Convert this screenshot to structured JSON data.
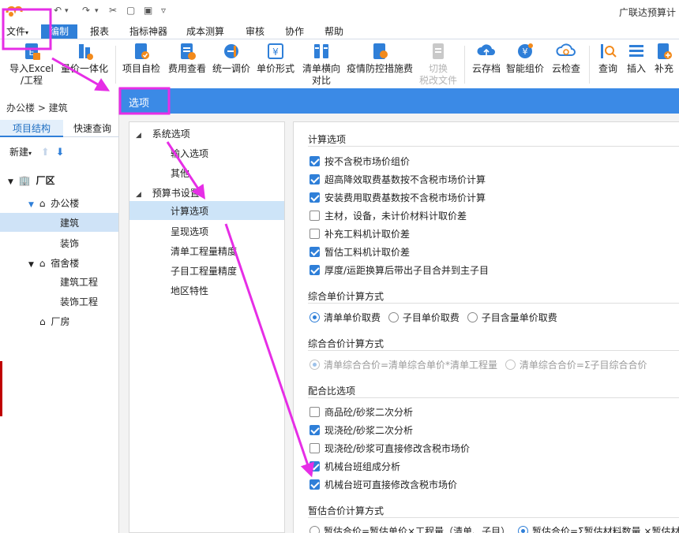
{
  "app": {
    "title": "广联达预算计",
    "quick_access": [
      "↶",
      "▾",
      "↷",
      "▾",
      "✂",
      "▢",
      "▣",
      "▿"
    ]
  },
  "menu": {
    "file": "文件",
    "tabs": [
      "编制",
      "报表",
      "指标神器",
      "成本测算",
      "审核",
      "协作",
      "帮助"
    ],
    "active_tab": "编制"
  },
  "toolbar": {
    "items": [
      {
        "label": "导入Excel",
        "label2": "/工程",
        "icon": "import-excel-icon"
      },
      {
        "label": "量价一体化",
        "label2": "",
        "icon": "quantity-price-icon"
      },
      {
        "label": "项目自检",
        "label2": "",
        "icon": "project-check-icon"
      },
      {
        "label": "费用查看",
        "label2": "",
        "icon": "cost-view-icon"
      },
      {
        "label": "统一调价",
        "label2": "",
        "icon": "price-adjust-icon"
      },
      {
        "label": "单价形式",
        "label2": "",
        "icon": "unit-price-icon"
      },
      {
        "label": "清单横向",
        "label2": "对比",
        "icon": "list-compare-icon"
      },
      {
        "label": "疫情防控措施费",
        "label2": "",
        "icon": "epidemic-fee-icon"
      },
      {
        "label": "切换",
        "label2": "税改文件",
        "icon": "tax-switch-icon"
      },
      {
        "label": "云存档",
        "label2": "",
        "icon": "cloud-archive-icon"
      },
      {
        "label": "智能组价",
        "label2": "",
        "icon": "smart-price-icon"
      },
      {
        "label": "云检查",
        "label2": "",
        "icon": "cloud-check-icon"
      },
      {
        "label": "查询",
        "label2": "",
        "icon": "query-icon"
      },
      {
        "label": "插入",
        "label2": "",
        "icon": "insert-icon"
      },
      {
        "label": "补充",
        "label2": "",
        "icon": "supplement-icon"
      }
    ]
  },
  "sidebar": {
    "breadcrumb": "办公楼 > 建筑",
    "tabs": [
      "项目结构",
      "快速查询"
    ],
    "new_label": "新建",
    "tree": [
      {
        "label": "厂区",
        "level": 0
      },
      {
        "label": "办公楼",
        "level": 1
      },
      {
        "label": "建筑",
        "level": 2
      },
      {
        "label": "装饰",
        "level": 2
      },
      {
        "label": "宿舍楼",
        "level": 1
      },
      {
        "label": "建筑工程",
        "level": 2
      },
      {
        "label": "装饰工程",
        "level": 2
      },
      {
        "label": "厂房",
        "level": 1
      }
    ]
  },
  "dialog": {
    "title": "选项",
    "tree": [
      {
        "label": "系统选项",
        "level": 0
      },
      {
        "label": "输入选项",
        "level": 1
      },
      {
        "label": "其他",
        "level": 1
      },
      {
        "label": "预算书设置",
        "level": 0
      },
      {
        "label": "计算选项",
        "level": 1
      },
      {
        "label": "呈现选项",
        "level": 1
      },
      {
        "label": "清单工程量精度",
        "level": 1
      },
      {
        "label": "子目工程量精度",
        "level": 1
      },
      {
        "label": "地区特性",
        "level": 1
      }
    ],
    "sections": {
      "calc": {
        "title": "计算选项",
        "options": [
          {
            "label": "按不含税市场价组价",
            "checked": true
          },
          {
            "label": "超高降效取费基数按不含税市场价计算",
            "checked": true
          },
          {
            "label": "安装费用取费基数按不含税市场价计算",
            "checked": true
          },
          {
            "label": "主材，设备，未计价材料计取价差",
            "checked": false
          },
          {
            "label": "补充工料机计取价差",
            "checked": false
          },
          {
            "label": "暂估工料机计取价差",
            "checked": true
          },
          {
            "label": "厚度/运距换算后带出子目合并到主子目",
            "checked": true
          }
        ]
      },
      "unit_price": {
        "title": "综合单价计算方式",
        "options": [
          {
            "label": "清单单价取费",
            "selected": true
          },
          {
            "label": "子目单价取费",
            "selected": false
          },
          {
            "label": "子目含量单价取费",
            "selected": false
          }
        ]
      },
      "total_price": {
        "title": "综合合价计算方式",
        "options": [
          {
            "label": "清单综合合价=清单综合单价*清单工程量",
            "selected": true
          },
          {
            "label": "清单综合合价=Σ子目综合合价",
            "selected": false
          }
        ]
      },
      "mix": {
        "title": "配合比选项",
        "options": [
          {
            "label": "商品砼/砂浆二次分析",
            "checked": false
          },
          {
            "label": "现浇砼/砂浆二次分析",
            "checked": true
          },
          {
            "label": "现浇砼/砂浆可直接修改含税市场价",
            "checked": false
          },
          {
            "label": "机械台班组成分析",
            "checked": true
          },
          {
            "label": "机械台班可直接修改含税市场价",
            "checked": true
          }
        ]
      },
      "estimate": {
        "title": "暂估合价计算方式",
        "options": [
          {
            "label": "暂估合价=暂估单价×工程量（清单、子目）",
            "selected": false
          },
          {
            "label": "暂估合价=Σ暂估材料数量 ×暂估材",
            "selected": true
          }
        ]
      }
    }
  },
  "colors": {
    "accent": "#2f7fd8",
    "dialog_header": "#3b8ae6",
    "annotation": "#e62ee6"
  }
}
